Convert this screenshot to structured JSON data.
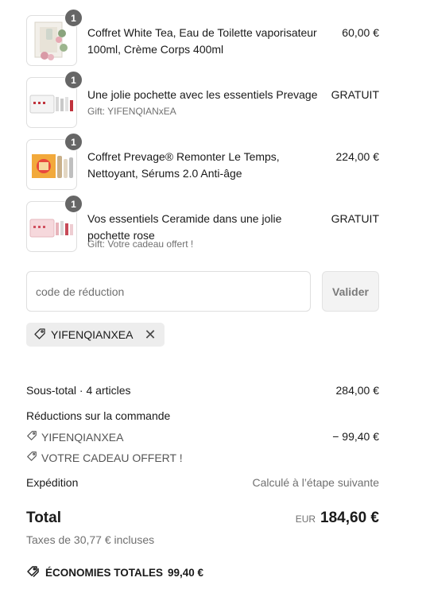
{
  "items": [
    {
      "quantity": "1",
      "name": "Coffret White Tea, Eau de Toilette vaporisateur 100ml, Crème Corps 400ml",
      "gift": "",
      "price": "60,00 €"
    },
    {
      "quantity": "1",
      "name": "Une jolie pochette avec les essentiels Prevage",
      "gift": "Gift: YIFENQIANxEA",
      "price": "GRATUIT"
    },
    {
      "quantity": "1",
      "name": "Coffret Prevage® Remonter Le Temps, Nettoyant, Sérums 2.0 Anti-âge",
      "gift": "",
      "price": "224,00 €"
    },
    {
      "quantity": "1",
      "name": "Vos essentiels Ceramide dans une jolie pochette rose",
      "gift": "Gift: Votre cadeau offert !",
      "price": "GRATUIT"
    }
  ],
  "discount": {
    "placeholder": "code de réduction",
    "apply_label": "Valider",
    "applied_code": "YIFENQIANXEA"
  },
  "summary": {
    "subtotal_label": "Sous-total · 4 articles",
    "subtotal_value": "284,00 €",
    "order_discounts_label": "Réductions sur la commande",
    "discount_lines": [
      {
        "code": "YIFENQIANXEA",
        "amount": "− 99,40 €"
      },
      {
        "code": "VOTRE CADEAU OFFERT !",
        "amount": ""
      }
    ],
    "shipping_label": "Expédition",
    "shipping_value": "Calculé à l’étape suivante",
    "total_label": "Total",
    "currency": "EUR",
    "total_value": "184,60 €",
    "taxes": "Taxes de 30,77 € incluses",
    "savings_label": "ÉCONOMIES TOTALES",
    "savings_value": "99,40 €"
  },
  "icons": {
    "tag": "tag-icon",
    "close": "close-icon",
    "savings": "price-tags-icon"
  }
}
